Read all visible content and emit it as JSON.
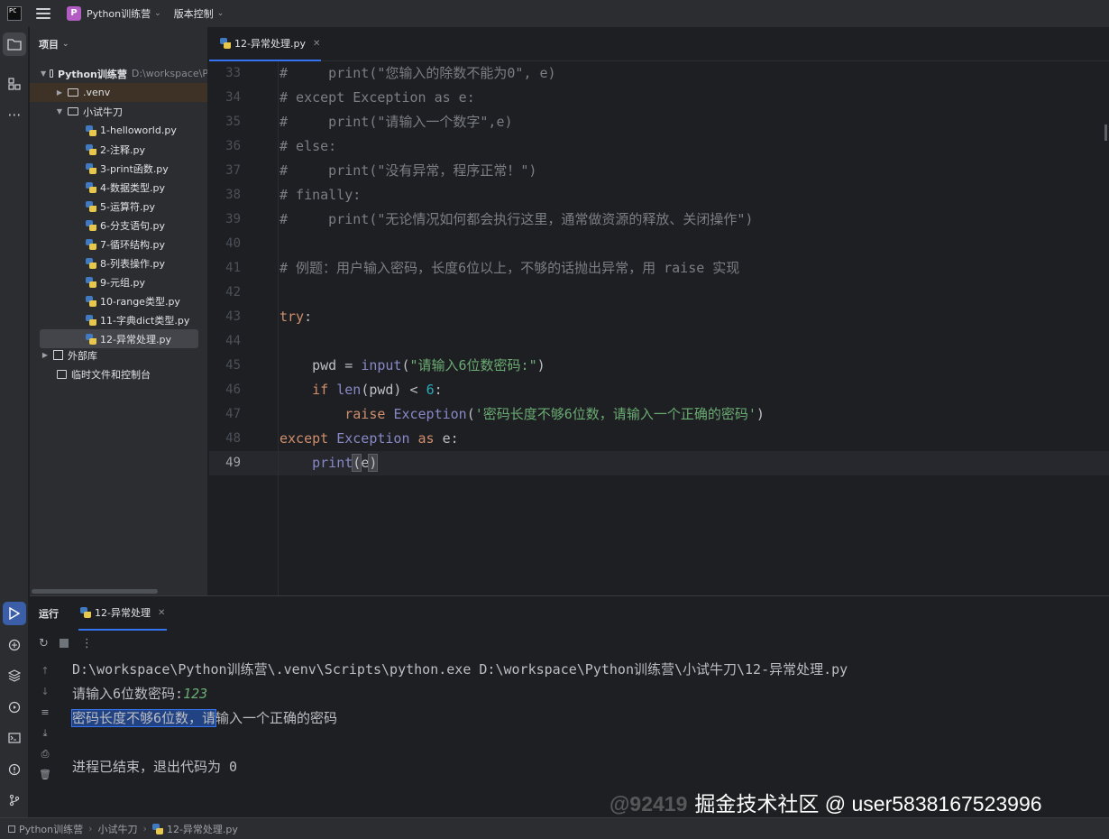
{
  "titlebar": {
    "app_logo": "PC",
    "project_badge": "P",
    "project_name": "Python训练营",
    "vcs_menu": "版本控制"
  },
  "project_panel": {
    "title": "项目",
    "root": {
      "name": "Python训练营",
      "path": "D:\\workspace\\P"
    },
    "venv": ".venv",
    "folder": "小试牛刀",
    "files": [
      "1-helloworld.py",
      "2-注释.py",
      "3-print函数.py",
      "4-数据类型.py",
      "5-运算符.py",
      "6-分支语句.py",
      "7-循环结构.py",
      "8-列表操作.py",
      "9-元组.py",
      "10-range类型.py",
      "11-字典dict类型.py",
      "12-异常处理.py"
    ],
    "external_libs": "外部库",
    "scratches": "临时文件和控制台"
  },
  "editor": {
    "tab_label": "12-异常处理.py",
    "lines": [
      {
        "n": "33",
        "comment": "#     print(\"您输入的除数不能为0\", e)"
      },
      {
        "n": "34",
        "comment": "# except Exception as e:"
      },
      {
        "n": "35",
        "comment": "#     print(\"请输入一个数字\",e)"
      },
      {
        "n": "36",
        "comment": "# else:"
      },
      {
        "n": "37",
        "comment": "#     print(\"没有异常，程序正常！\")"
      },
      {
        "n": "38",
        "comment": "# finally:"
      },
      {
        "n": "39",
        "comment": "#     print(\"无论情况如何都会执行这里，通常做资源的释放、关闭操作\")"
      },
      {
        "n": "40"
      },
      {
        "n": "41",
        "comment": "# 例题：用户输入密码，长度6位以上，不够的话抛出异常，用 raise 实现"
      },
      {
        "n": "42"
      },
      {
        "n": "43",
        "try": "try",
        "colon": ":"
      },
      {
        "n": "44"
      },
      {
        "n": "45",
        "var": "pwd",
        "eq": " = ",
        "fn": "input",
        "lp": "(",
        "s": "\"请输入6位数密码:\"",
        "rp": ")"
      },
      {
        "n": "46",
        "kw": "if",
        "fn": "len",
        "mid": "(pwd) < ",
        "num": "6",
        "end": ":"
      },
      {
        "n": "47",
        "kw": "raise",
        "cls": "Exception",
        "lp": "(",
        "s": "'密码长度不够6位数，请输入一个正确的密码'",
        "rp": ")"
      },
      {
        "n": "48",
        "kw": "except",
        "cls": "Exception",
        "kw2": "as",
        "end": " e:"
      },
      {
        "n": "49",
        "fn": "print",
        "lp": "(",
        "arg": "e",
        "rp": ")"
      }
    ]
  },
  "run": {
    "title": "运行",
    "tab_label": "12-异常处理",
    "command": "D:\\workspace\\Python训练营\\.venv\\Scripts\\python.exe D:\\workspace\\Python训练营\\小试牛刀\\12-异常处理.py",
    "prompt": "请输入6位数密码:",
    "input_value": "123",
    "error_selected": "密码长度不够6位数，请",
    "error_rest": "输入一个正确的密码",
    "exit_message": "进程已结束，退出代码为 0"
  },
  "statusbar": {
    "crumbs": [
      "Python训练营",
      "小试牛刀",
      "12-异常处理.py"
    ]
  },
  "watermark": {
    "user_id": "@92419",
    "text": "掘金技术社区 @ user5838167523996"
  },
  "colors": {
    "background": "#1e1f22",
    "panel": "#2b2d30",
    "accent": "#3574f0",
    "keyword": "#cf8e6d",
    "string": "#6aab73",
    "comment": "#7a7e85",
    "number": "#2aacb8",
    "builtin": "#8888c6",
    "project_badge": "#b35cc3"
  }
}
